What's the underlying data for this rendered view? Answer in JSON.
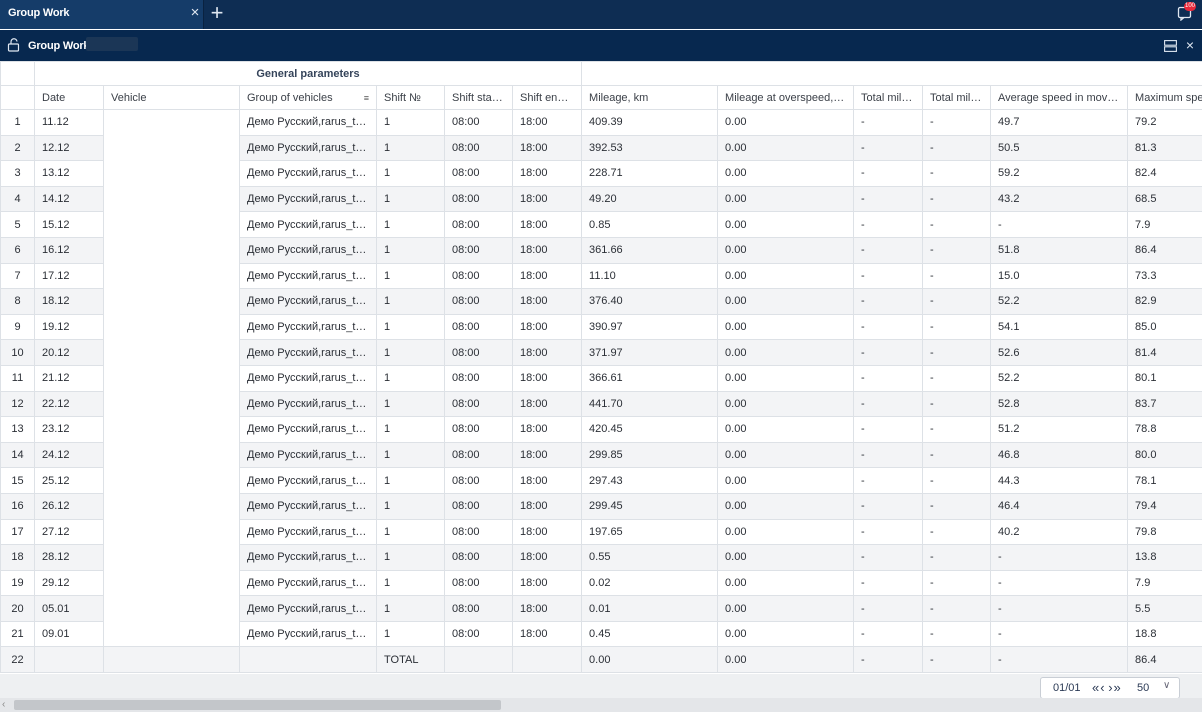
{
  "tabbar": {
    "tab_label": "Group Work",
    "close_glyph": "×",
    "add_glyph": "+",
    "notification_count": "100"
  },
  "panel": {
    "title": "Group Work",
    "close_glyph": "×"
  },
  "table": {
    "group_header": "General parameters",
    "columns": [
      "Date",
      "Vehicle",
      "Group of vehicles",
      "Shift №",
      "Shift start...",
      "Shift end t...",
      "Mileage, km",
      "Mileage at overspeed, km",
      "Total mile...",
      "Total mile...",
      "Average speed in movem...",
      "Maximum spee"
    ],
    "rows": [
      {
        "n": "1",
        "date": "11.12",
        "vehicle": "",
        "group": "Демо Русский,rarus_test",
        "shift": "1",
        "start": "08:00",
        "end": "18:00",
        "mileage": "409.39",
        "overspeed": "0.00",
        "total1": "-",
        "total2": "-",
        "avg": "49.7",
        "max": "79.2"
      },
      {
        "n": "2",
        "date": "12.12",
        "vehicle": "",
        "group": "Демо Русский,rarus_test",
        "shift": "1",
        "start": "08:00",
        "end": "18:00",
        "mileage": "392.53",
        "overspeed": "0.00",
        "total1": "-",
        "total2": "-",
        "avg": "50.5",
        "max": "81.3"
      },
      {
        "n": "3",
        "date": "13.12",
        "vehicle": "",
        "group": "Демо Русский,rarus_test",
        "shift": "1",
        "start": "08:00",
        "end": "18:00",
        "mileage": "228.71",
        "overspeed": "0.00",
        "total1": "-",
        "total2": "-",
        "avg": "59.2",
        "max": "82.4"
      },
      {
        "n": "4",
        "date": "14.12",
        "vehicle": "",
        "group": "Демо Русский,rarus_test",
        "shift": "1",
        "start": "08:00",
        "end": "18:00",
        "mileage": "49.20",
        "overspeed": "0.00",
        "total1": "-",
        "total2": "-",
        "avg": "43.2",
        "max": "68.5"
      },
      {
        "n": "5",
        "date": "15.12",
        "vehicle": "",
        "group": "Демо Русский,rarus_test",
        "shift": "1",
        "start": "08:00",
        "end": "18:00",
        "mileage": "0.85",
        "overspeed": "0.00",
        "total1": "-",
        "total2": "-",
        "avg": "-",
        "max": "7.9"
      },
      {
        "n": "6",
        "date": "16.12",
        "vehicle": "",
        "group": "Демо Русский,rarus_test",
        "shift": "1",
        "start": "08:00",
        "end": "18:00",
        "mileage": "361.66",
        "overspeed": "0.00",
        "total1": "-",
        "total2": "-",
        "avg": "51.8",
        "max": "86.4"
      },
      {
        "n": "7",
        "date": "17.12",
        "vehicle": "",
        "group": "Демо Русский,rarus_test",
        "shift": "1",
        "start": "08:00",
        "end": "18:00",
        "mileage": "11.10",
        "overspeed": "0.00",
        "total1": "-",
        "total2": "-",
        "avg": "15.0",
        "max": "73.3"
      },
      {
        "n": "8",
        "date": "18.12",
        "vehicle": "",
        "group": "Демо Русский,rarus_test",
        "shift": "1",
        "start": "08:00",
        "end": "18:00",
        "mileage": "376.40",
        "overspeed": "0.00",
        "total1": "-",
        "total2": "-",
        "avg": "52.2",
        "max": "82.9"
      },
      {
        "n": "9",
        "date": "19.12",
        "vehicle": "",
        "group": "Демо Русский,rarus_test",
        "shift": "1",
        "start": "08:00",
        "end": "18:00",
        "mileage": "390.97",
        "overspeed": "0.00",
        "total1": "-",
        "total2": "-",
        "avg": "54.1",
        "max": "85.0"
      },
      {
        "n": "10",
        "date": "20.12",
        "vehicle": "",
        "group": "Демо Русский,rarus_test",
        "shift": "1",
        "start": "08:00",
        "end": "18:00",
        "mileage": "371.97",
        "overspeed": "0.00",
        "total1": "-",
        "total2": "-",
        "avg": "52.6",
        "max": "81.4"
      },
      {
        "n": "11",
        "date": "21.12",
        "vehicle": "",
        "group": "Демо Русский,rarus_test",
        "shift": "1",
        "start": "08:00",
        "end": "18:00",
        "mileage": "366.61",
        "overspeed": "0.00",
        "total1": "-",
        "total2": "-",
        "avg": "52.2",
        "max": "80.1"
      },
      {
        "n": "12",
        "date": "22.12",
        "vehicle": "",
        "group": "Демо Русский,rarus_test",
        "shift": "1",
        "start": "08:00",
        "end": "18:00",
        "mileage": "441.70",
        "overspeed": "0.00",
        "total1": "-",
        "total2": "-",
        "avg": "52.8",
        "max": "83.7"
      },
      {
        "n": "13",
        "date": "23.12",
        "vehicle": "",
        "group": "Демо Русский,rarus_test",
        "shift": "1",
        "start": "08:00",
        "end": "18:00",
        "mileage": "420.45",
        "overspeed": "0.00",
        "total1": "-",
        "total2": "-",
        "avg": "51.2",
        "max": "78.8"
      },
      {
        "n": "14",
        "date": "24.12",
        "vehicle": "",
        "group": "Демо Русский,rarus_test",
        "shift": "1",
        "start": "08:00",
        "end": "18:00",
        "mileage": "299.85",
        "overspeed": "0.00",
        "total1": "-",
        "total2": "-",
        "avg": "46.8",
        "max": "80.0"
      },
      {
        "n": "15",
        "date": "25.12",
        "vehicle": "",
        "group": "Демо Русский,rarus_test",
        "shift": "1",
        "start": "08:00",
        "end": "18:00",
        "mileage": "297.43",
        "overspeed": "0.00",
        "total1": "-",
        "total2": "-",
        "avg": "44.3",
        "max": "78.1"
      },
      {
        "n": "16",
        "date": "26.12",
        "vehicle": "",
        "group": "Демо Русский,rarus_test",
        "shift": "1",
        "start": "08:00",
        "end": "18:00",
        "mileage": "299.45",
        "overspeed": "0.00",
        "total1": "-",
        "total2": "-",
        "avg": "46.4",
        "max": "79.4"
      },
      {
        "n": "17",
        "date": "27.12",
        "vehicle": "",
        "group": "Демо Русский,rarus_test",
        "shift": "1",
        "start": "08:00",
        "end": "18:00",
        "mileage": "197.65",
        "overspeed": "0.00",
        "total1": "-",
        "total2": "-",
        "avg": "40.2",
        "max": "79.8"
      },
      {
        "n": "18",
        "date": "28.12",
        "vehicle": "",
        "group": "Демо Русский,rarus_test",
        "shift": "1",
        "start": "08:00",
        "end": "18:00",
        "mileage": "0.55",
        "overspeed": "0.00",
        "total1": "-",
        "total2": "-",
        "avg": "-",
        "max": "13.8"
      },
      {
        "n": "19",
        "date": "29.12",
        "vehicle": "",
        "group": "Демо Русский,rarus_test",
        "shift": "1",
        "start": "08:00",
        "end": "18:00",
        "mileage": "0.02",
        "overspeed": "0.00",
        "total1": "-",
        "total2": "-",
        "avg": "-",
        "max": "7.9"
      },
      {
        "n": "20",
        "date": "05.01",
        "vehicle": "",
        "group": "Демо Русский,rarus_test",
        "shift": "1",
        "start": "08:00",
        "end": "18:00",
        "mileage": "0.01",
        "overspeed": "0.00",
        "total1": "-",
        "total2": "-",
        "avg": "-",
        "max": "5.5"
      },
      {
        "n": "21",
        "date": "09.01",
        "vehicle": "",
        "group": "Демо Русский,rarus_test",
        "shift": "1",
        "start": "08:00",
        "end": "18:00",
        "mileage": "0.45",
        "overspeed": "0.00",
        "total1": "-",
        "total2": "-",
        "avg": "-",
        "max": "18.8"
      },
      {
        "n": "22",
        "date": "",
        "vehicle": "",
        "group": "",
        "shift": "TOTAL",
        "start": "",
        "end": "",
        "mileage": "0.00",
        "overspeed": "0.00",
        "total1": "-",
        "total2": "-",
        "avg": "-",
        "max": "86.4"
      }
    ]
  },
  "pager": {
    "page": "01/01",
    "page_size": "50"
  },
  "colors": {
    "tabbar_bg": "#0e2d53",
    "panel_bg": "#07284f",
    "notification_badge": "#e8293b"
  }
}
